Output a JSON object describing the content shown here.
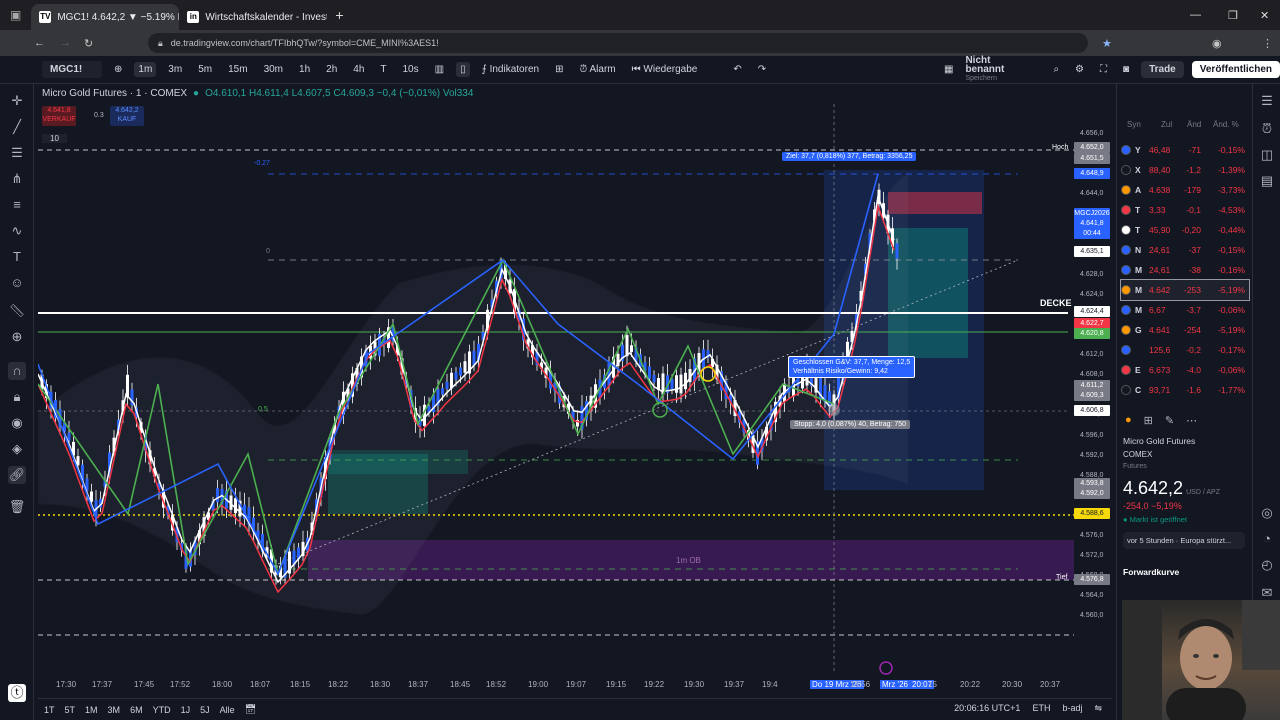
{
  "browser": {
    "tabs": [
      {
        "title": "MGC1! 4.642,2 ▼ −5.19% Nicht",
        "fav": "TV",
        "active": true
      },
      {
        "title": "Wirtschaftskalender - Investing",
        "fav": "in",
        "active": false
      }
    ],
    "url": "de.tradingview.com/chart/TFIbhQTw/?symbol=CME_MINI%3AES1!"
  },
  "toolbar": {
    "symbol": "MGC1!",
    "intervals": [
      "1m",
      "3m",
      "5m",
      "15m",
      "30m",
      "1h",
      "2h",
      "4h",
      "T",
      "10s"
    ],
    "indicators": "Indikatoren",
    "alarm": "Alarm",
    "replay": "Wiedergabe",
    "layout_name": "Nicht benannt",
    "layout_sub": "Speichern",
    "trade": "Trade",
    "publish": "Veröffentlichen"
  },
  "legend": {
    "title": "Micro Gold Futures · 1 · COMEX",
    "ohlc": "O4.610,1  H4.611,4  L4.607,5  C4.609,3  −0,4 (−0,01%)  Vol334",
    "sell_price": "4.641,8",
    "sell_label": "VERKAUF",
    "spread": "0.3",
    "buy_price": "4.642,2",
    "buy_label": "KAUF",
    "qty": "10"
  },
  "annotations": {
    "target": "Ziel: 37,7 (0,818%) 377, Betrag: 3356,25",
    "closed_line1": "Geschlossen G&V: 37,7, Menge: 12,5",
    "closed_line2": "Verhältnis Risiko/Gewinn: 9,42",
    "stop": "Stopp: 4,0 (0,087%) 40, Betrag: 750",
    "decke": "DECKE",
    "ob": "1m OB",
    "hoch": "Hoch",
    "tief": "Tief",
    "level_05": "0.5",
    "level_0": "0",
    "level_neg": "-0.27"
  },
  "price_scale": {
    "ticks": [
      "4.656,0",
      "4.652,0",
      "4.648,0",
      "4.644,0",
      "4.640,0",
      "4.636,0",
      "4.632,0",
      "4.628,0",
      "4.624,0",
      "4.620,0",
      "4.616,0",
      "4.612,0",
      "4.608,0",
      "4.604,0",
      "4.600,0",
      "4.596,0",
      "4.592,0",
      "4.588,0",
      "4.584,0",
      "4.580,0",
      "4.576,0",
      "4.572,0",
      "4.568,0",
      "4.564,0",
      "4.560,0"
    ],
    "labels": [
      {
        "text": "4.652,0",
        "color": "#787b86"
      },
      {
        "text": "4.651,5",
        "color": "#787b86"
      },
      {
        "text": "4.648,9",
        "color": "#2962ff"
      },
      {
        "text": "MGCJ2026",
        "color": "#2962ff"
      },
      {
        "text": "4.641,8",
        "color": "#2962ff"
      },
      {
        "text": "00:44",
        "color": "#2962ff"
      },
      {
        "text": "4.635,1",
        "color": "#ffffff"
      },
      {
        "text": "4.624,4",
        "color": "#ffffff"
      },
      {
        "text": "4.622,7",
        "color": "#f23645"
      },
      {
        "text": "4.620,8",
        "color": "#4caf50"
      },
      {
        "text": "4.611,2",
        "color": "#787b86"
      },
      {
        "text": "4.609,3",
        "color": "#787b86"
      },
      {
        "text": "4.606,8",
        "color": "#ffffff"
      },
      {
        "text": "4.593,8",
        "color": "#787b86"
      },
      {
        "text": "4.592,0",
        "color": "#787b86"
      },
      {
        "text": "4.588,6",
        "color": "#f5d90a"
      },
      {
        "text": "4.576,8",
        "color": "#787b86"
      }
    ]
  },
  "time_scale": [
    "17:30",
    "17:37",
    "17:45",
    "17:52",
    "18:00",
    "18:07",
    "18:15",
    "18:22",
    "18:30",
    "18:37",
    "18:45",
    "18:52",
    "19:00",
    "19:07",
    "19:15",
    "19:22",
    "19:30",
    "19:37",
    "19:4",
    "Do 19 Mrz '26",
    "19:56",
    "Mrz '26",
    "20:07",
    "15",
    "20:22",
    "20:30",
    "20:37"
  ],
  "bottom": {
    "ranges": [
      "1T",
      "5T",
      "1M",
      "3M",
      "6M",
      "YTD",
      "1J",
      "5J",
      "Alle"
    ],
    "time": "20:06:16 UTC+1",
    "session": "ETH",
    "adj": "b-adj"
  },
  "watchlist": {
    "headers": [
      "Syn",
      "Zul",
      "Änd",
      "Änd. %"
    ],
    "rows": [
      {
        "sym": "Y",
        "last": "46,48",
        "chg": "-71",
        "pct": "-0,15%",
        "color": "#2962ff"
      },
      {
        "sym": "X",
        "last": "88,40",
        "chg": "-1,2",
        "pct": "-1,39%",
        "color": "#131722"
      },
      {
        "sym": "A",
        "last": "4.638",
        "chg": "-179",
        "pct": "-3,73%",
        "color": "#ff9800"
      },
      {
        "sym": "T",
        "last": "3,33",
        "chg": "-0,1",
        "pct": "-4,53%",
        "color": "#f23645"
      },
      {
        "sym": "T",
        "last": "45,90",
        "chg": "-0,20",
        "pct": "-0,44%",
        "color": "#ffffff"
      },
      {
        "sym": "N",
        "last": "24,61",
        "chg": "-37",
        "pct": "-0,15%",
        "color": "#2962ff"
      },
      {
        "sym": "M",
        "last": "24,61",
        "chg": "-38",
        "pct": "-0,16%",
        "color": "#2962ff"
      },
      {
        "sym": "M",
        "last": "4.642",
        "chg": "-253",
        "pct": "-5,19%",
        "color": "#ff9800"
      },
      {
        "sym": "M",
        "last": "6,67",
        "chg": "-3,7",
        "pct": "-0,06%",
        "color": "#2962ff"
      },
      {
        "sym": "G",
        "last": "4.641",
        "chg": "-254",
        "pct": "-5,19%",
        "color": "#ff9800"
      },
      {
        "sym": "",
        "last": "125,6",
        "chg": "-0,2",
        "pct": "-0,17%",
        "color": "#2962ff"
      },
      {
        "sym": "E",
        "last": "6,673",
        "chg": "-4,0",
        "pct": "-0,06%",
        "color": "#f23645"
      },
      {
        "sym": "C",
        "last": "93,71",
        "chg": "-1,6",
        "pct": "-1,77%",
        "color": "#131722"
      }
    ]
  },
  "detail": {
    "name": "Micro Gold Futures",
    "exchange": "COMEX",
    "type": "Futures",
    "price": "4.642,2",
    "currency": "USD / APZ",
    "change": "-254,0  −5,19%",
    "status": "Markt ist geöffnet",
    "news": "vor 5 Stunden · Europa stürzt...",
    "forward": "Forwardkurve"
  }
}
